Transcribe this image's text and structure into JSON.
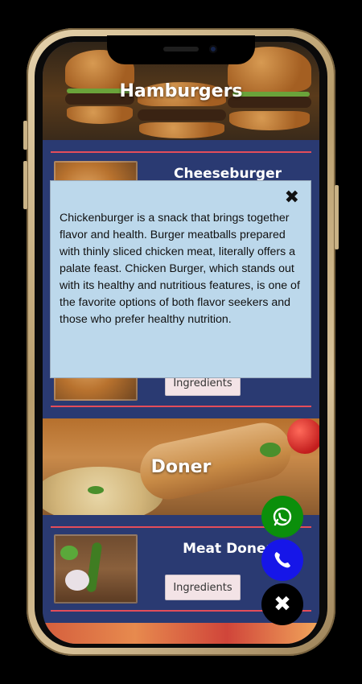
{
  "sections": [
    {
      "title": "Hamburgers"
    },
    {
      "title": "Doner"
    }
  ],
  "items": [
    {
      "name": "Cheeseburger",
      "button": "Ingredients"
    },
    {
      "name": "Meat Doner",
      "button": "Ingredients"
    }
  ],
  "popup": {
    "close_icon": "close-icon",
    "text": "Chickenburger is a snack that brings together flavor and health. Burger meatballs prepared with thinly sliced chicken meat, literally offers a palate feast. Chicken Burger, which stands out with its healthy and nutritious features, is one of the favorite options of both flavor seekers and those who prefer healthy nutrition."
  },
  "fabs": {
    "whatsapp_icon": "whatsapp-icon",
    "call_icon": "phone-icon",
    "close_icon": "close-icon"
  },
  "colors": {
    "list_background": "#2a3a72",
    "divider": "#e44d5a",
    "popup_background": "#bcd8eb",
    "whatsapp": "#0b8f0b",
    "call": "#1616e8"
  }
}
